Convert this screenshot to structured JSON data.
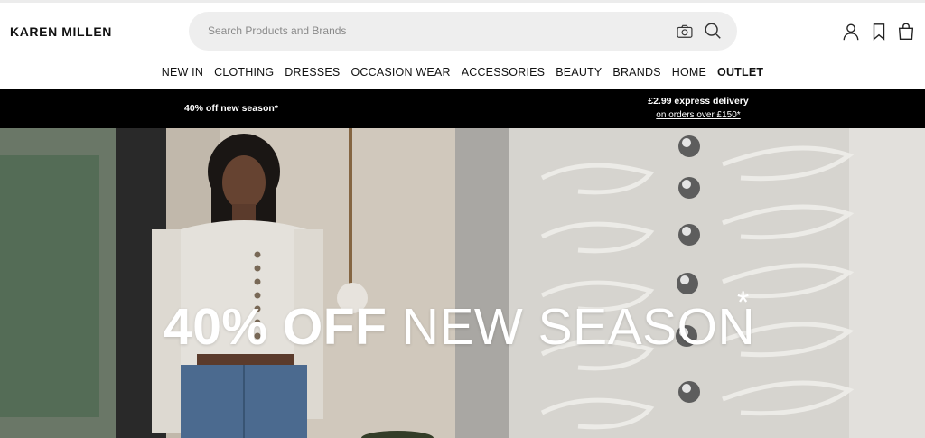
{
  "brand": {
    "logo": "KAREN MILLEN"
  },
  "search": {
    "placeholder": "Search Products and Brands"
  },
  "header_icons": [
    "camera-icon",
    "search-icon",
    "account-icon",
    "bookmark-icon",
    "bag-icon"
  ],
  "nav": {
    "items": [
      "NEW IN",
      "CLOTHING",
      "DRESSES",
      "OCCASION WEAR",
      "ACCESSORIES",
      "BEAUTY",
      "BRANDS",
      "HOME",
      "OUTLET"
    ]
  },
  "promo": {
    "left_text": "40% off new season*",
    "right_line1": "£2.99 express delivery",
    "right_line2": "on orders over £150*"
  },
  "hero": {
    "headline_bold": "40% OFF",
    "headline_light": "NEW SEASON",
    "asterisk": "*"
  },
  "colors": {
    "promo_bg": "#000000",
    "search_bg": "#eeeeee",
    "text": "#111111"
  }
}
